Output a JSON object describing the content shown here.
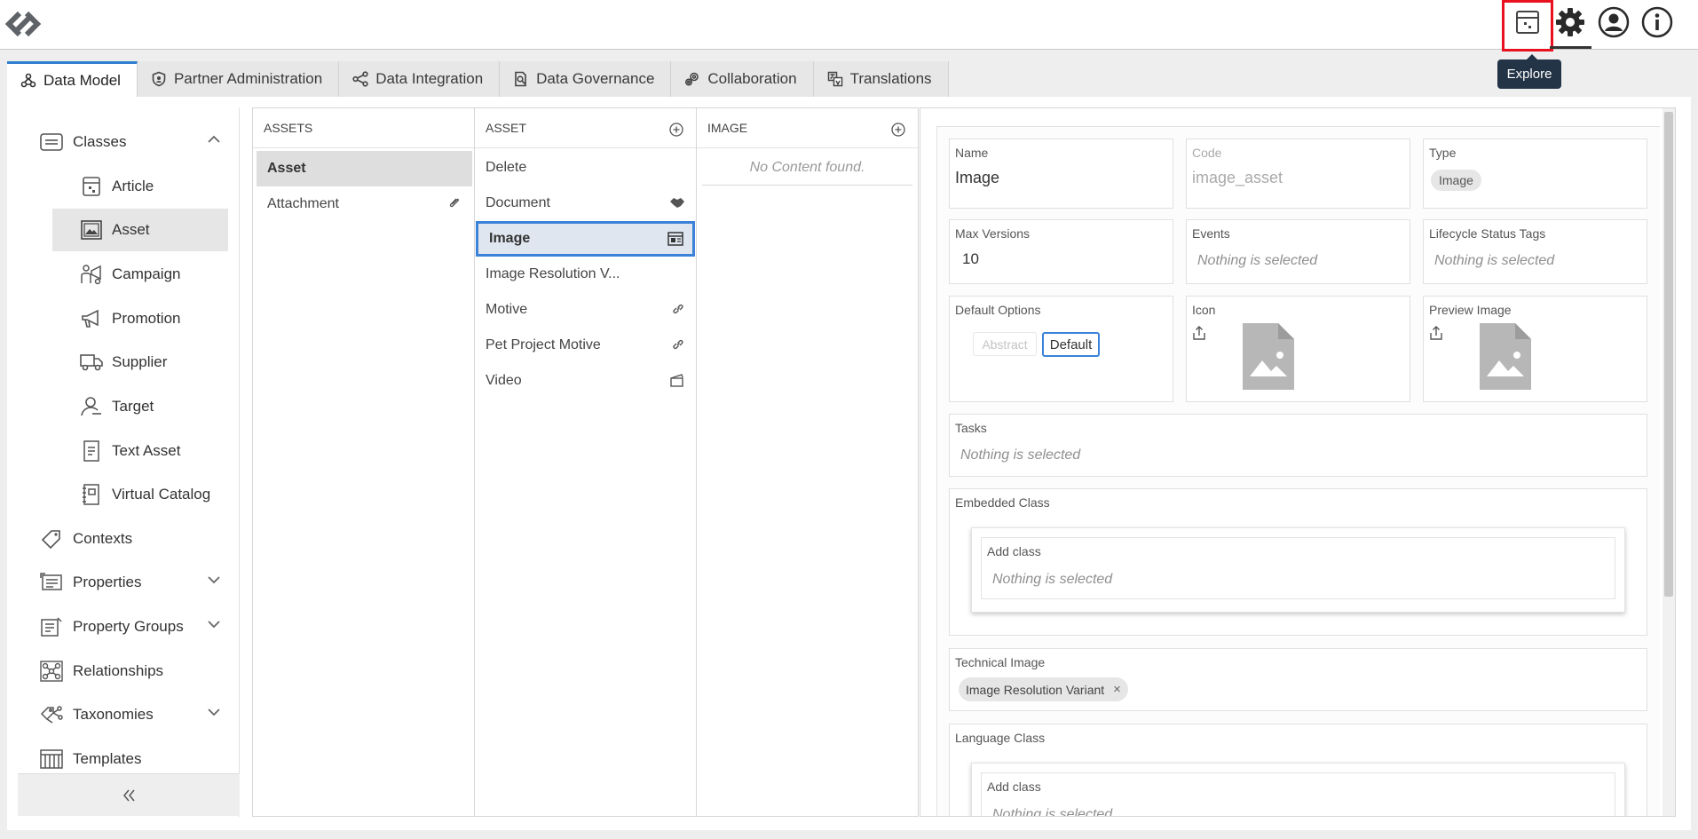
{
  "header": {
    "tooltip": "Explore",
    "icons": [
      "app-logo-icon",
      "explore-icon",
      "settings-gear-icon",
      "user-profile-icon",
      "info-icon"
    ]
  },
  "tabs": [
    {
      "label": "Data Model",
      "icon": "data-model-icon",
      "active": true
    },
    {
      "label": "Partner Administration",
      "icon": "shield-icon"
    },
    {
      "label": "Data Integration",
      "icon": "integration-icon"
    },
    {
      "label": "Data Governance",
      "icon": "governance-icon"
    },
    {
      "label": "Collaboration",
      "icon": "collaboration-icon"
    },
    {
      "label": "Translations",
      "icon": "translations-icon"
    }
  ],
  "sidebar": {
    "classes": "Classes",
    "items": [
      "Article",
      "Asset",
      "Campaign",
      "Promotion",
      "Supplier",
      "Target",
      "Text Asset",
      "Virtual Catalog"
    ],
    "selected": "Asset",
    "contexts": "Contexts",
    "properties": "Properties",
    "property_groups": "Property Groups",
    "relationships": "Relationships",
    "taxonomies": "Taxonomies",
    "templates": "Templates"
  },
  "columns": {
    "assets": {
      "header": "ASSETS",
      "items": [
        "Asset",
        "Attachment"
      ]
    },
    "asset": {
      "header": "ASSET",
      "items": [
        "Delete",
        "Document",
        "Image",
        "Image Resolution V...",
        "Motive",
        "Pet Project Motive",
        "Video"
      ]
    },
    "image": {
      "header": "IMAGE",
      "empty": "No Content found."
    }
  },
  "detail": {
    "name_label": "Name",
    "name_value": "Image",
    "code_label": "Code",
    "code_value": "image_asset",
    "type_label": "Type",
    "type_value": "Image",
    "maxv_label": "Max Versions",
    "maxv_value": "10",
    "events_label": "Events",
    "lifecycle_label": "Lifecycle Status Tags",
    "defopt_label": "Default Options",
    "abstract_label": "Abstract",
    "default_label": "Default",
    "icon_label": "Icon",
    "preview_label": "Preview Image",
    "tasks_label": "Tasks",
    "embedded_label": "Embedded Class",
    "add_class_label": "Add class",
    "tech_label": "Technical Image",
    "tech_chip": "Image Resolution Variant",
    "lang_label": "Language Class",
    "nothing": "Nothing is selected"
  }
}
